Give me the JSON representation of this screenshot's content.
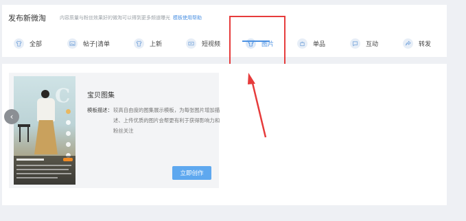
{
  "header": {
    "title": "发布新微淘",
    "description": "内容质量与粉丝效果好的微淘可以得到更多频道曝光",
    "help_link": "模板使用帮助"
  },
  "tabs": [
    {
      "label": "全部",
      "icon": "shirt-icon"
    },
    {
      "label": "帖子|清单",
      "icon": "image-icon"
    },
    {
      "label": "上新",
      "icon": "shirt-icon"
    },
    {
      "label": "短视频",
      "icon": "video-icon"
    },
    {
      "label": "图片",
      "icon": "shirt-icon",
      "active": true
    },
    {
      "label": "单品",
      "icon": "bag-icon"
    },
    {
      "label": "互动",
      "icon": "chat-icon"
    },
    {
      "label": "转发",
      "icon": "share-icon"
    }
  ],
  "template": {
    "title": "宝贝图集",
    "desc_label": "模板描述：",
    "desc_text": "较高自由度的图集展示模板，为每张图片增加描述、上传优质的图片会帮更有利于获得影响力和粉丝关注",
    "create_button": "立即创作"
  },
  "colors": {
    "accent": "#4a90e2",
    "annotation": "#e63b3b",
    "button": "#5ea8ef"
  }
}
